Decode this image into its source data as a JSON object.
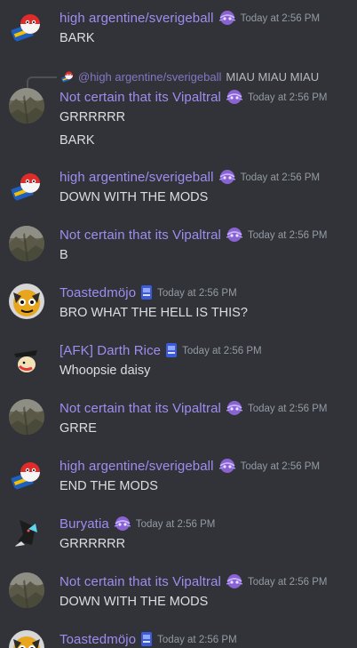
{
  "colors": {
    "background": "#313338",
    "username": "#a08cf0",
    "text": "#dbdee1",
    "timestamp": "#949ba4"
  },
  "messages": [
    {
      "author": "high argentine/sverigeball",
      "tag_icon": "nitro-badge-icon",
      "avatar": "flag-ball-avatar",
      "timestamp": "Today at 2:56 PM",
      "lines": [
        "BARK"
      ]
    },
    {
      "reply": {
        "mention": "@high argentine/sverigeball",
        "text": "MIAU MIAU MIAU"
      },
      "author": "Not certain that its Vipaltral",
      "tag_icon": "nitro-badge-icon",
      "avatar": "rocky-landscape-avatar",
      "timestamp": "Today at 2:56 PM",
      "lines": [
        "GRRRRRR",
        "BARK"
      ]
    },
    {
      "author": "high argentine/sverigeball",
      "tag_icon": "nitro-badge-icon",
      "avatar": "flag-ball-avatar",
      "timestamp": "Today at 2:56 PM",
      "lines": [
        "DOWN WITH THE MODS"
      ]
    },
    {
      "author": "Not certain that its Vipaltral",
      "tag_icon": "nitro-badge-icon",
      "avatar": "rocky-landscape-avatar",
      "timestamp": "Today at 2:56 PM",
      "lines": [
        "B"
      ]
    },
    {
      "author": "Toastedmöjo",
      "tag_icon": "card-badge-icon",
      "avatar": "cartoon-creature-avatar",
      "timestamp": "Today at 2:56 PM",
      "lines": [
        "BRO WHAT THE HELL IS THIS?"
      ]
    },
    {
      "author": "[AFK] Darth Rice",
      "tag_icon": "card-badge-icon",
      "avatar": "pointing-figure-avatar",
      "timestamp": "Today at 2:56 PM",
      "lines": [
        "Whoopsie daisy"
      ]
    },
    {
      "author": "Not certain that its Vipaltral",
      "tag_icon": "nitro-badge-icon",
      "avatar": "rocky-landscape-avatar",
      "timestamp": "Today at 2:56 PM",
      "lines": [
        "GRRE"
      ]
    },
    {
      "author": "high argentine/sverigeball",
      "tag_icon": "nitro-badge-icon",
      "avatar": "flag-ball-avatar",
      "timestamp": "Today at 2:56 PM",
      "lines": [
        "END THE MODS"
      ]
    },
    {
      "author": "Buryatia",
      "tag_icon": "nitro-badge-icon",
      "avatar": "dark-creature-avatar",
      "timestamp": "Today at 2:56 PM",
      "lines": [
        "GRRRRRR"
      ]
    },
    {
      "author": "Not certain that its Vipaltral",
      "tag_icon": "nitro-badge-icon",
      "avatar": "rocky-landscape-avatar",
      "timestamp": "Today at 2:56 PM",
      "lines": [
        "DOWN WITH THE MODS"
      ]
    },
    {
      "author": "Toastedmöjo",
      "tag_icon": "card-badge-icon",
      "avatar": "cartoon-creature-avatar",
      "timestamp": "Today at 2:56 PM",
      "lines": []
    }
  ]
}
